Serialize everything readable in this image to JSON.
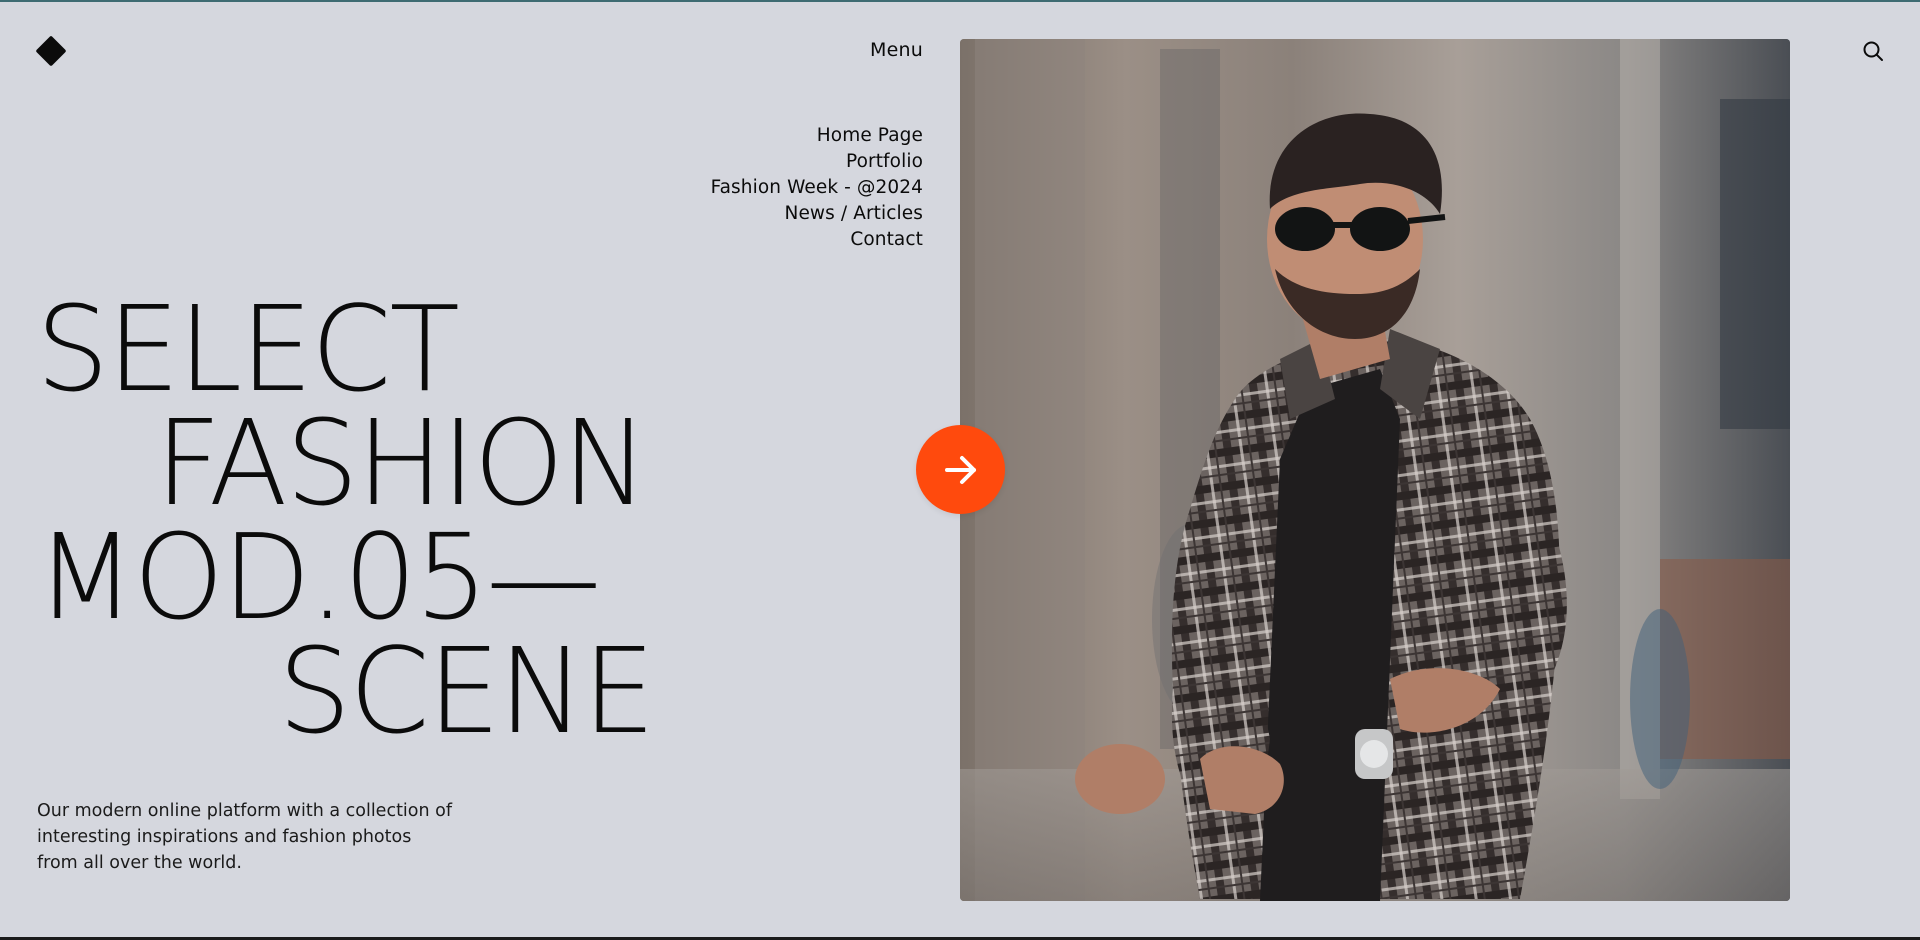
{
  "header": {
    "logo_icon": "diamond-logo-icon",
    "menu_label": "Menu",
    "search_icon": "search-icon"
  },
  "nav": {
    "items": [
      {
        "label": "Home Page"
      },
      {
        "label": "Portfolio"
      },
      {
        "label": "Fashion Week - @2024"
      },
      {
        "label": "News / Articles"
      },
      {
        "label": "Contact"
      }
    ]
  },
  "hero": {
    "headline_lines": [
      "SELECT",
      "FASHION",
      "MOD.05—",
      "SCENE"
    ],
    "description_lines": [
      "Our modern online platform with a collection of",
      "interesting inspirations and fashion photos",
      "from all over the world."
    ],
    "next_icon": "arrow-right-icon",
    "image": "man-in-plaid-shirt-sunglasses-photo"
  },
  "colors": {
    "background": "#d5d7de",
    "accent": "#ff4a0d",
    "text": "#0b0b0b"
  }
}
